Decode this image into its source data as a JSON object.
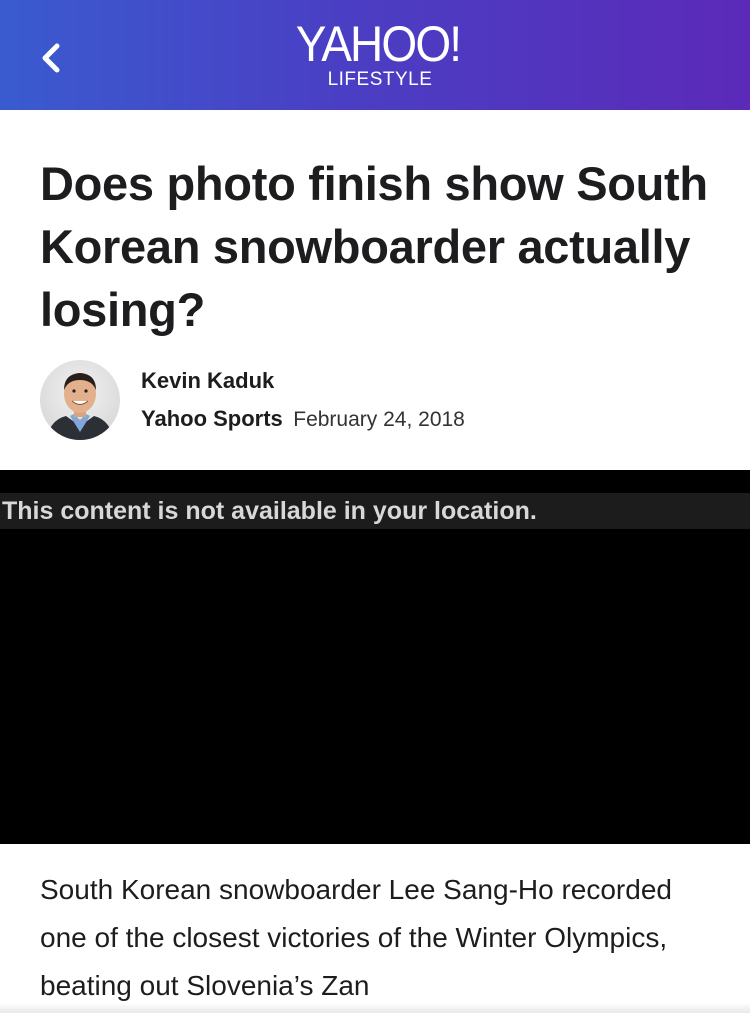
{
  "header": {
    "logo_text": "YAHOO!",
    "logo_subtitle": "LIFESTYLE",
    "back_icon": "chevron-left-icon",
    "gradient_start": "#3a5bd0",
    "gradient_end": "#5b2ab8"
  },
  "article": {
    "headline": "Does photo finish show South Korean snowboarder actually losing?",
    "author": "Kevin Kaduk",
    "source": "Yahoo Sports",
    "date": "February 24, 2018",
    "video_notice": "This content is not available in your location.",
    "body_text": "South Korean snowboarder Lee Sang-Ho recorded one of the closest victories of the Winter Olympics, beating out Slovenia’s Zan"
  }
}
